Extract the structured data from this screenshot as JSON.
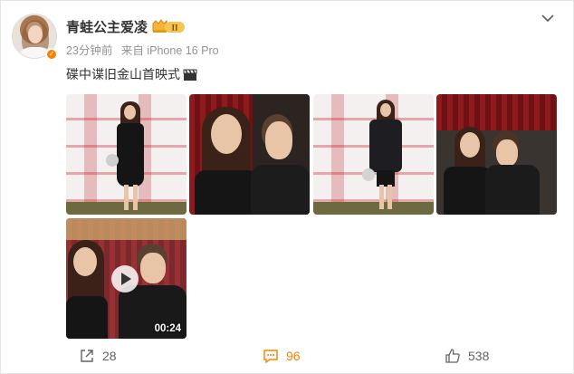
{
  "post": {
    "author": {
      "name": "青蛙公主爱凌",
      "avatar_icon": "user-avatar",
      "verified_icon": "verified-badge-icon",
      "membership_icon": "vip-crown-badge-icon",
      "membership_level": "II"
    },
    "meta": {
      "time": "23分钟前",
      "source": "来自 iPhone 16 Pro"
    },
    "caption": "碟中谍旧金山首映式",
    "caption_emoji_icon": "clapperboard-icon",
    "media": [
      {
        "type": "image",
        "description_icon": "photo"
      },
      {
        "type": "image",
        "description_icon": "photo"
      },
      {
        "type": "image",
        "description_icon": "photo"
      },
      {
        "type": "image",
        "description_icon": "photo"
      },
      {
        "type": "video",
        "duration": "00:24"
      }
    ],
    "actions": {
      "share_count": "28",
      "comment_count": "96",
      "like_count": "538"
    },
    "colors": {
      "accent": "#f78100",
      "text": "#333333",
      "meta": "#939393"
    }
  }
}
